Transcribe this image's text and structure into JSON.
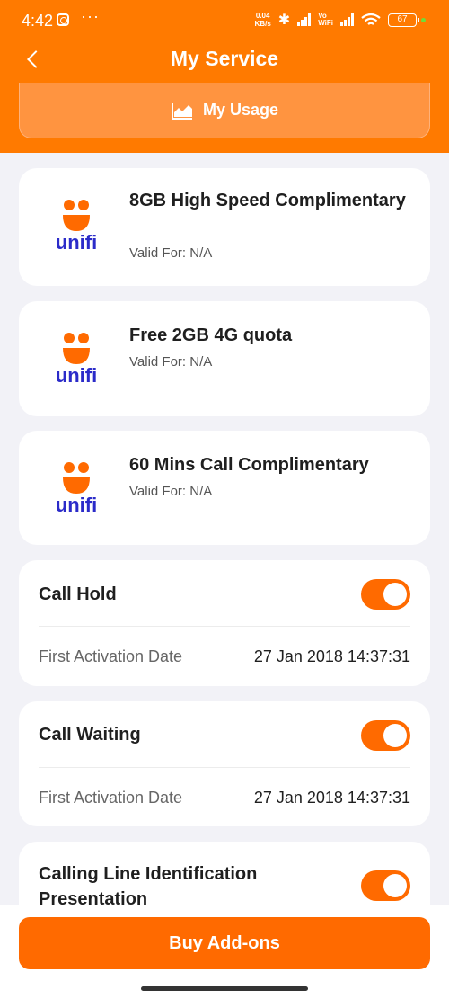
{
  "status_bar": {
    "time": "4:42",
    "speed_value": "0.04",
    "speed_unit": "KB/s",
    "vowifi_top": "Vo",
    "vowifi_bottom": "WiFi",
    "battery": "67"
  },
  "header": {
    "title": "My Service",
    "usage_label": "My Usage"
  },
  "colors": {
    "brand_orange": "#ff7a00",
    "button_orange": "#ff6a00",
    "unifi_blue": "#2b2bc9"
  },
  "promotions": [
    {
      "title": "8GB High Speed Complimentary",
      "valid": "Valid For: N/A",
      "logo_text": "unifi"
    },
    {
      "title": "Free 2GB 4G quota",
      "valid": "Valid For: N/A",
      "logo_text": "unifi"
    },
    {
      "title": "60 Mins Call Complimentary",
      "valid": "Valid For: N/A",
      "logo_text": "unifi"
    }
  ],
  "services": [
    {
      "title": "Call Hold",
      "enabled": true,
      "date_label": "First Activation Date",
      "date_value": "27 Jan 2018 14:37:31"
    },
    {
      "title": "Call Waiting",
      "enabled": true,
      "date_label": "First Activation Date",
      "date_value": "27 Jan 2018 14:37:31"
    },
    {
      "title": "Calling Line Identification Presentation",
      "enabled": true
    }
  ],
  "footer": {
    "buy_label": "Buy Add-ons"
  }
}
